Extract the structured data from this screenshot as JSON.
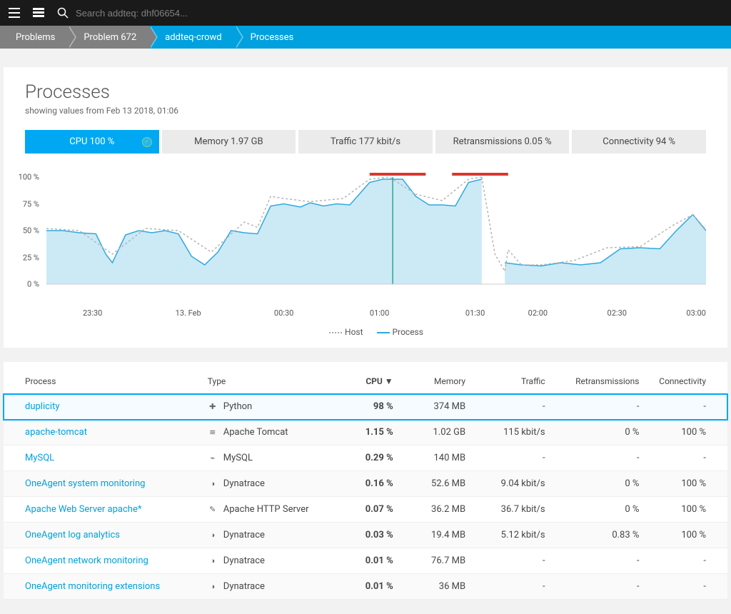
{
  "topbar": {
    "search_placeholder": "Search addteq: dhf06654..."
  },
  "breadcrumbs": [
    "Problems",
    "Problem 672",
    "addteq-crowd",
    "Processes"
  ],
  "header": {
    "title": "Processes",
    "subtitle": "showing values from Feb 13 2018, 01:06"
  },
  "metricTabs": [
    {
      "label": "CPU 100 %",
      "active": true,
      "check": true
    },
    {
      "label": "Memory 1.97 GB"
    },
    {
      "label": "Traffic 177 kbit/s"
    },
    {
      "label": "Retransmissions 0.05 %"
    },
    {
      "label": "Connectivity 94 %"
    }
  ],
  "chart_data": {
    "type": "line",
    "ylabel": "",
    "ylim": [
      0,
      100
    ],
    "yticks": [
      "0 %",
      "25 %",
      "50 %",
      "75 %",
      "100 %"
    ],
    "xticks": [
      "23:30",
      "13. Feb",
      "00:30",
      "01:00",
      "01:30",
      "02:00",
      "02:30",
      "03:00"
    ],
    "xtick_pos": [
      0.07,
      0.215,
      0.36,
      0.505,
      0.65,
      0.745,
      0.865,
      0.985
    ],
    "legend": [
      "Host",
      "Process"
    ],
    "cursor_x": 0.525,
    "anomaly_bars": [
      [
        0.49,
        0.575
      ],
      [
        0.615,
        0.7
      ]
    ],
    "series": [
      {
        "name": "Process",
        "color": "#2fa9de",
        "fill": "#cce9f6",
        "x": [
          0,
          0.025,
          0.05,
          0.075,
          0.09,
          0.1,
          0.12,
          0.14,
          0.16,
          0.18,
          0.2,
          0.22,
          0.24,
          0.26,
          0.28,
          0.3,
          0.32,
          0.34,
          0.36,
          0.385,
          0.4,
          0.42,
          0.44,
          0.46,
          0.49,
          0.51,
          0.54,
          0.56,
          0.58,
          0.6,
          0.62,
          0.64,
          0.66
        ],
        "y": [
          50,
          50,
          48,
          47,
          28,
          20,
          46,
          50,
          48,
          50,
          47,
          26,
          18,
          30,
          50,
          48,
          47,
          73,
          75,
          72,
          76,
          73,
          75,
          74,
          95,
          98,
          98,
          82,
          74,
          74,
          73,
          95,
          98
        ]
      },
      {
        "name": "Process2",
        "color": "#2fa9de",
        "fill": "#cce9f6",
        "x": [
          0.695,
          0.72,
          0.75,
          0.78,
          0.81,
          0.84,
          0.87,
          0.9,
          0.93,
          0.955,
          0.98,
          1.0
        ],
        "y": [
          20,
          18,
          17,
          20,
          18,
          20,
          33,
          34,
          33,
          50,
          65,
          50
        ]
      },
      {
        "name": "Host",
        "color": "#b5b5b5",
        "dashed": true,
        "x": [
          0,
          0.05,
          0.1,
          0.15,
          0.2,
          0.25,
          0.3,
          0.32,
          0.34,
          0.36,
          0.4,
          0.45,
          0.49,
          0.52,
          0.56,
          0.6,
          0.64,
          0.66
        ],
        "y": [
          52,
          50,
          28,
          52,
          50,
          30,
          58,
          53,
          82,
          80,
          77,
          80,
          98,
          100,
          84,
          78,
          98,
          100
        ]
      },
      {
        "name": "Host2",
        "color": "#b5b5b5",
        "dashed": true,
        "x": [
          0.66,
          0.68,
          0.695,
          0.7,
          0.72,
          0.75,
          0.8,
          0.85,
          0.9,
          0.95,
          0.98,
          1.0
        ],
        "y": [
          100,
          28,
          12,
          32,
          18,
          18,
          22,
          34,
          35,
          55,
          65,
          51
        ]
      }
    ]
  },
  "tableHeaders": {
    "process": "Process",
    "type": "Type",
    "cpu": "CPU ▼",
    "memory": "Memory",
    "traffic": "Traffic",
    "retrans": "Retransmissions",
    "conn": "Connectivity"
  },
  "rows": [
    {
      "name": "duplicity",
      "icon": "✚",
      "type": "Python",
      "cpu": "98 %",
      "mem": "374 MB",
      "traffic": "-",
      "retrans": "-",
      "conn": "-",
      "highlight": true
    },
    {
      "name": "apache-tomcat",
      "icon": "≋",
      "type": "Apache Tomcat",
      "cpu": "1.15 %",
      "mem": "1.02 GB",
      "traffic": "115 kbit/s",
      "retrans": "0 %",
      "conn": "100 %"
    },
    {
      "name": "MySQL",
      "icon": "⌁",
      "type": "MySQL",
      "cpu": "0.29 %",
      "mem": "140 MB",
      "traffic": "-",
      "retrans": "-",
      "conn": "-"
    },
    {
      "name": "OneAgent system monitoring",
      "icon": "◑",
      "type": "Dynatrace",
      "cpu": "0.16 %",
      "mem": "52.6 MB",
      "traffic": "9.04 kbit/s",
      "retrans": "0 %",
      "conn": "100 %"
    },
    {
      "name": "Apache Web Server apache*",
      "icon": "✎",
      "type": "Apache HTTP Server",
      "cpu": "0.07 %",
      "mem": "36.2 MB",
      "traffic": "36.7 kbit/s",
      "retrans": "0 %",
      "conn": "100 %"
    },
    {
      "name": "OneAgent log analytics",
      "icon": "◑",
      "type": "Dynatrace",
      "cpu": "0.03 %",
      "mem": "19.4 MB",
      "traffic": "5.12 kbit/s",
      "retrans": "0.83 %",
      "conn": "100 %"
    },
    {
      "name": "OneAgent network monitoring",
      "icon": "◑",
      "type": "Dynatrace",
      "cpu": "0.01 %",
      "mem": "76.7 MB",
      "traffic": "-",
      "retrans": "-",
      "conn": "-"
    },
    {
      "name": "OneAgent monitoring extensions",
      "icon": "◑",
      "type": "Dynatrace",
      "cpu": "0.01 %",
      "mem": "36 MB",
      "traffic": "-",
      "retrans": "-",
      "conn": "-"
    }
  ]
}
